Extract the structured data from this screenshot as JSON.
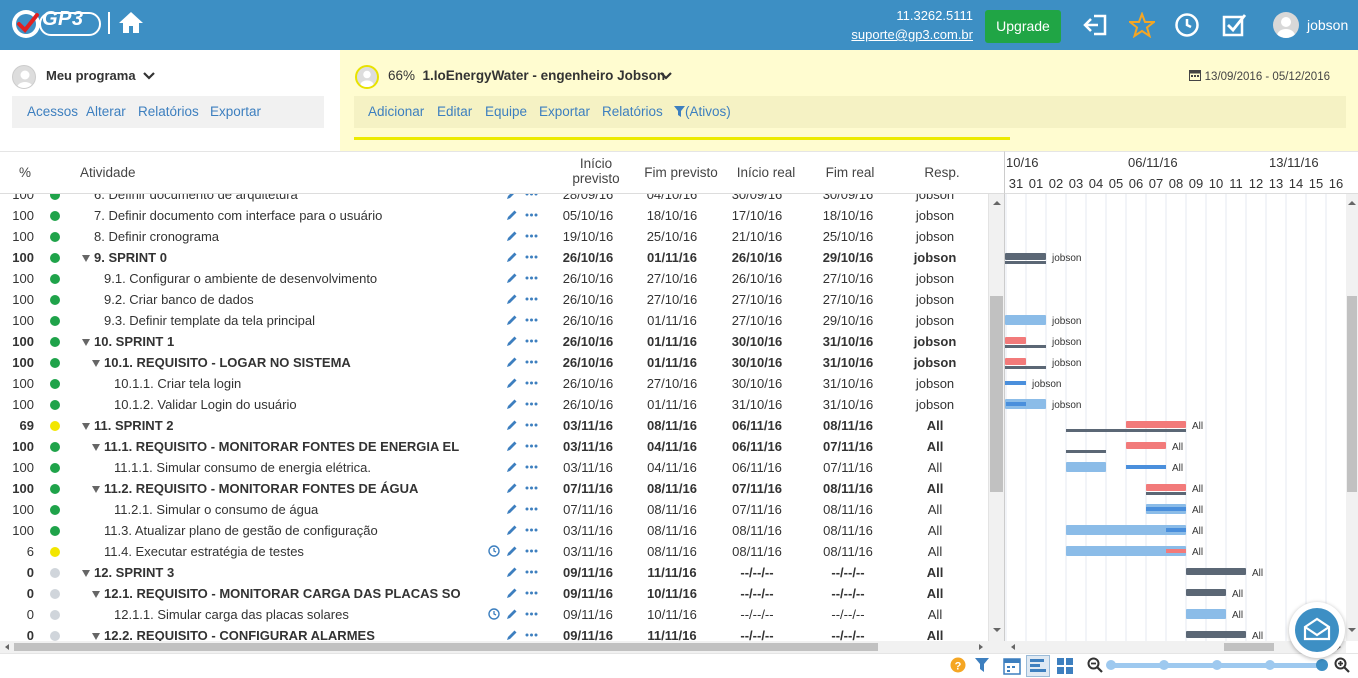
{
  "topbar": {
    "logo_text": "GP3",
    "phone": "11.3262.5111",
    "email": "suporte@gp3.com.br",
    "upgrade_label": "Upgrade",
    "username": "jobson",
    "bg_color": "#3d8fc4",
    "upgrade_color": "#20a545"
  },
  "program": {
    "title": "Meu programa",
    "menu": [
      "Acessos",
      "Alterar",
      "Relatórios",
      "Exportar"
    ]
  },
  "project": {
    "percent": "66%",
    "title": "1.IoEnergyWater - engenheiro Jobson",
    "dates": "13/09/2016 - 05/12/2016",
    "menu": [
      "Adicionar",
      "Editar",
      "Equipe",
      "Exportar",
      "Relatórios"
    ],
    "filter_label": "(Ativos)",
    "progress": 0.66
  },
  "grid": {
    "headers": {
      "pct": "%",
      "activity": "Atividade",
      "start_plan_1": "Início",
      "start_plan_2": "previsto",
      "end_plan": "Fim previsto",
      "start_real": "Início real",
      "end_real": "Fim real",
      "resp": "Resp."
    },
    "rows": [
      {
        "pct": "100",
        "status": "green",
        "name": "6. Definir documento de arquitetura",
        "indent": 1,
        "bold": false,
        "toggle": false,
        "clock": false,
        "sp": "28/09/16",
        "ep": "04/10/16",
        "sr": "30/09/16",
        "er": "30/09/16",
        "resp": "jobson"
      },
      {
        "pct": "100",
        "status": "green",
        "name": "7. Definir documento com interface para o usuário",
        "indent": 1,
        "bold": false,
        "toggle": false,
        "clock": false,
        "sp": "05/10/16",
        "ep": "18/10/16",
        "sr": "17/10/16",
        "er": "18/10/16",
        "resp": "jobson"
      },
      {
        "pct": "100",
        "status": "green",
        "name": "8. Definir cronograma",
        "indent": 1,
        "bold": false,
        "toggle": false,
        "clock": false,
        "sp": "19/10/16",
        "ep": "25/10/16",
        "sr": "21/10/16",
        "er": "25/10/16",
        "resp": "jobson"
      },
      {
        "pct": "100",
        "status": "green",
        "name": "9. SPRINT 0",
        "indent": 1,
        "bold": true,
        "toggle": true,
        "clock": false,
        "sp": "26/10/16",
        "ep": "01/11/16",
        "sr": "26/10/16",
        "er": "29/10/16",
        "resp": "jobson"
      },
      {
        "pct": "100",
        "status": "green",
        "name": "9.1. Configurar o ambiente de desenvolvimento",
        "indent": 2,
        "bold": false,
        "toggle": false,
        "clock": false,
        "sp": "26/10/16",
        "ep": "27/10/16",
        "sr": "26/10/16",
        "er": "27/10/16",
        "resp": "jobson"
      },
      {
        "pct": "100",
        "status": "green",
        "name": "9.2. Criar banco de dados",
        "indent": 2,
        "bold": false,
        "toggle": false,
        "clock": false,
        "sp": "26/10/16",
        "ep": "27/10/16",
        "sr": "27/10/16",
        "er": "27/10/16",
        "resp": "jobson"
      },
      {
        "pct": "100",
        "status": "green",
        "name": "9.3. Definir template da tela principal",
        "indent": 2,
        "bold": false,
        "toggle": false,
        "clock": false,
        "sp": "26/10/16",
        "ep": "01/11/16",
        "sr": "27/10/16",
        "er": "29/10/16",
        "resp": "jobson"
      },
      {
        "pct": "100",
        "status": "green",
        "name": "10. SPRINT 1",
        "indent": 1,
        "bold": true,
        "toggle": true,
        "clock": false,
        "sp": "26/10/16",
        "ep": "01/11/16",
        "sr": "30/10/16",
        "er": "31/10/16",
        "resp": "jobson"
      },
      {
        "pct": "100",
        "status": "green",
        "name": "10.1. REQUISITO - LOGAR NO SISTEMA",
        "indent": 2,
        "bold": true,
        "toggle": true,
        "clock": false,
        "sp": "26/10/16",
        "ep": "01/11/16",
        "sr": "30/10/16",
        "er": "31/10/16",
        "resp": "jobson"
      },
      {
        "pct": "100",
        "status": "green",
        "name": "10.1.1. Criar tela login",
        "indent": 3,
        "bold": false,
        "toggle": false,
        "clock": false,
        "sp": "26/10/16",
        "ep": "27/10/16",
        "sr": "30/10/16",
        "er": "31/10/16",
        "resp": "jobson"
      },
      {
        "pct": "100",
        "status": "green",
        "name": "10.1.2. Validar Login do usuário",
        "indent": 3,
        "bold": false,
        "toggle": false,
        "clock": false,
        "sp": "26/10/16",
        "ep": "01/11/16",
        "sr": "31/10/16",
        "er": "31/10/16",
        "resp": "jobson"
      },
      {
        "pct": "69",
        "status": "yellow",
        "name": "11. SPRINT 2",
        "indent": 1,
        "bold": true,
        "toggle": true,
        "clock": false,
        "sp": "03/11/16",
        "ep": "08/11/16",
        "sr": "06/11/16",
        "er": "08/11/16",
        "resp": "All"
      },
      {
        "pct": "100",
        "status": "green",
        "name": "11.1. REQUISITO - MONITORAR FONTES DE ENERGIA EL",
        "indent": 2,
        "bold": true,
        "toggle": true,
        "clock": false,
        "sp": "03/11/16",
        "ep": "04/11/16",
        "sr": "06/11/16",
        "er": "07/11/16",
        "resp": "All"
      },
      {
        "pct": "100",
        "status": "green",
        "name": "11.1.1. Simular consumo de energia elétrica.",
        "indent": 3,
        "bold": false,
        "toggle": false,
        "clock": false,
        "sp": "03/11/16",
        "ep": "04/11/16",
        "sr": "06/11/16",
        "er": "07/11/16",
        "resp": "All"
      },
      {
        "pct": "100",
        "status": "green",
        "name": "11.2. REQUISITO - MONITORAR FONTES DE ÁGUA",
        "indent": 2,
        "bold": true,
        "toggle": true,
        "clock": false,
        "sp": "07/11/16",
        "ep": "08/11/16",
        "sr": "07/11/16",
        "er": "08/11/16",
        "resp": "All"
      },
      {
        "pct": "100",
        "status": "green",
        "name": "11.2.1. Simular o consumo de água",
        "indent": 3,
        "bold": false,
        "toggle": false,
        "clock": false,
        "sp": "07/11/16",
        "ep": "08/11/16",
        "sr": "07/11/16",
        "er": "08/11/16",
        "resp": "All"
      },
      {
        "pct": "100",
        "status": "green",
        "name": "11.3. Atualizar plano de gestão de configuração",
        "indent": 2,
        "bold": false,
        "toggle": false,
        "clock": false,
        "sp": "03/11/16",
        "ep": "08/11/16",
        "sr": "08/11/16",
        "er": "08/11/16",
        "resp": "All"
      },
      {
        "pct": "6",
        "status": "yellow",
        "name": "11.4. Executar estratégia de testes",
        "indent": 2,
        "bold": false,
        "toggle": false,
        "clock": true,
        "sp": "03/11/16",
        "ep": "08/11/16",
        "sr": "08/11/16",
        "er": "08/11/16",
        "resp": "All"
      },
      {
        "pct": "0",
        "status": "grey",
        "name": "12. SPRINT 3",
        "indent": 1,
        "bold": true,
        "toggle": true,
        "clock": false,
        "sp": "09/11/16",
        "ep": "11/11/16",
        "sr": "--/--/--",
        "er": "--/--/--",
        "resp": "All"
      },
      {
        "pct": "0",
        "status": "grey",
        "name": "12.1. REQUISITO - MONITORAR CARGA DAS PLACAS SO",
        "indent": 2,
        "bold": true,
        "toggle": true,
        "clock": false,
        "sp": "09/11/16",
        "ep": "10/11/16",
        "sr": "--/--/--",
        "er": "--/--/--",
        "resp": "All"
      },
      {
        "pct": "0",
        "status": "grey",
        "name": "12.1.1. Simular carga das placas solares",
        "indent": 3,
        "bold": false,
        "toggle": false,
        "clock": true,
        "sp": "09/11/16",
        "ep": "10/11/16",
        "sr": "--/--/--",
        "er": "--/--/--",
        "resp": "All"
      },
      {
        "pct": "0",
        "status": "grey",
        "name": "12.2. REQUISITO - CONFIGURAR ALARMES",
        "indent": 2,
        "bold": true,
        "toggle": true,
        "clock": false,
        "sp": "09/11/16",
        "ep": "11/11/16",
        "sr": "--/--/--",
        "er": "--/--/--",
        "resp": "All"
      }
    ]
  },
  "gantt": {
    "weeks": [
      "10/16",
      "06/11/16",
      "13/11/16"
    ],
    "days": [
      "31",
      "01",
      "02",
      "03",
      "04",
      "05",
      "06",
      "07",
      "08",
      "09",
      "10",
      "11",
      "12",
      "13",
      "14",
      "15",
      "16"
    ],
    "colors": {
      "planned_summary": "#5b6775",
      "real": "#f27a7a",
      "planned": "#8bbce8",
      "complete": "#4a8fdc"
    }
  },
  "status_colors": {
    "green": "#1fa34a",
    "yellow": "#f2e600",
    "grey": "#d0d5db"
  }
}
